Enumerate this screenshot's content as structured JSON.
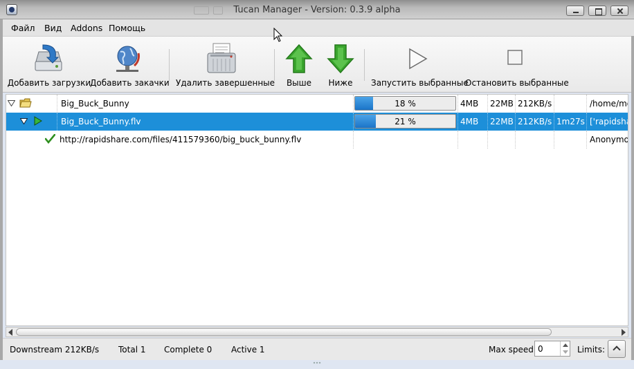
{
  "window": {
    "title": "Tucan Manager - Version: 0.3.9 alpha"
  },
  "menu": {
    "file": "Файл",
    "view": "Вид",
    "addons": "Addons",
    "help": "Помощь"
  },
  "toolbar": {
    "add_downloads": "Добавить загрузки",
    "add_uploads": "Добавить закачки",
    "remove_completed": "Удалить завершенные",
    "up": "Выше",
    "down": "Ниже",
    "start_selected": "Запустить выбранные",
    "stop_selected": "Остановить выбранные"
  },
  "downloads": {
    "package": {
      "name": "Big_Buck_Bunny",
      "progress_text": "18 %",
      "progress": 0.18,
      "downloaded": "4MB",
      "total": "22MB",
      "speed": "212KB/s",
      "time": "",
      "path": "/home/moo"
    },
    "file": {
      "name": "Big_Buck_Bunny.flv",
      "progress_text": "21 %",
      "progress": 0.21,
      "downloaded": "4MB",
      "total": "22MB",
      "speed": "212KB/s",
      "time": "1m27s",
      "plugins": "['rapidsha"
    },
    "link": {
      "url": "http://rapidshare.com/files/411579360/big_buck_bunny.flv",
      "account": "Anonymous"
    }
  },
  "statusbar": {
    "downstream": "Downstream 212KB/s",
    "total": "Total 1",
    "complete": "Complete 0",
    "active": "Active 1",
    "max_speed_label": "Max speed:",
    "max_speed_value": "0",
    "limits_label": "Limits:"
  },
  "colors": {
    "selection": "#1d8fd9",
    "progress_fill": "#1a74c8",
    "arrow_green": "#35a62b"
  }
}
